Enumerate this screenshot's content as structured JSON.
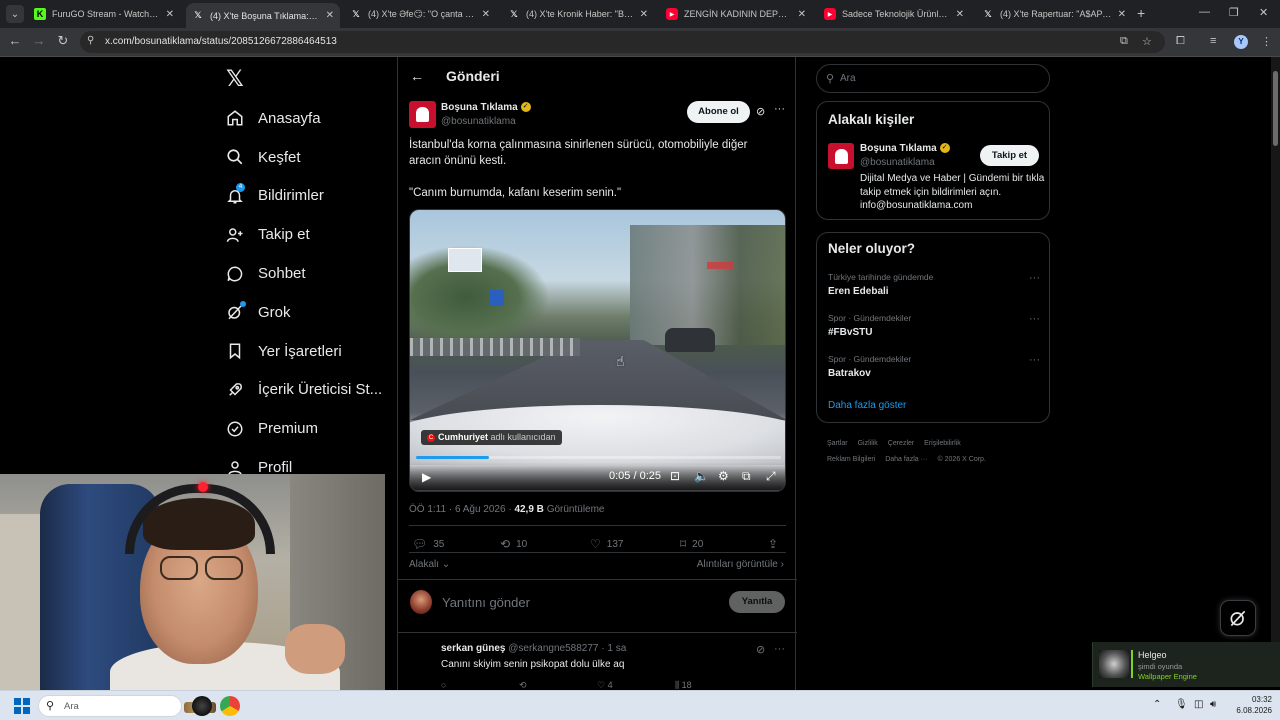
{
  "browser": {
    "tabs": [
      {
        "title": "FuruGO Stream - Watch Live on",
        "favicon": "kick-icon",
        "active": false
      },
      {
        "title": "(4) X'te Boşuna Tıklama: \"İstanb",
        "favicon": "x-icon",
        "active": true
      },
      {
        "title": "(4) X'te Əfe😏: \"O çanta ne aq",
        "favicon": "x-icon",
        "active": false
      },
      {
        "title": "(4) X'te Kronik Haber: \"Bir ev kı",
        "favicon": "x-icon",
        "active": false
      },
      {
        "title": "ZENGİN KADININ DEPOSUNU...",
        "favicon": "youtube-icon",
        "active": false
      },
      {
        "title": "Sadece Teknolojik Ürünler! Top",
        "favicon": "youtube-icon",
        "active": false
      },
      {
        "title": "(4) X'te Rapertuar: \"A$AP Rocky",
        "favicon": "x-icon",
        "active": false
      }
    ],
    "url": "x.com/bosunatiklama/status/2085126672886464513",
    "profile_initial": "Y"
  },
  "nav": {
    "items": [
      {
        "label": "Anasayfa",
        "icon": "home-icon"
      },
      {
        "label": "Keşfet",
        "icon": "search-icon"
      },
      {
        "label": "Bildirimler",
        "icon": "bell-icon",
        "badge": "4"
      },
      {
        "label": "Takip et",
        "icon": "person-add-icon"
      },
      {
        "label": "Sohbet",
        "icon": "chat-icon"
      },
      {
        "label": "Grok",
        "icon": "grok-icon"
      },
      {
        "label": "Yer İşaretleri",
        "icon": "bookmark-icon"
      },
      {
        "label": "İçerik Üreticisi St...",
        "icon": "rocket-icon"
      },
      {
        "label": "Premium",
        "icon": "verified-icon"
      },
      {
        "label": "Profil",
        "icon": "profile-icon"
      }
    ]
  },
  "post": {
    "header_title": "Gönderi",
    "author_name": "Boşuna Tıklama",
    "author_handle": "@bosunatiklama",
    "subscribe_label": "Abone ol",
    "text": "İstanbul'da korna çalınmasına sinirlenen sürücü, otomobiliyle diğer aracın önünü kesti.\n\n\"Canım burnumda, kafanı keserim senin.\"",
    "video": {
      "credit_source": "Cumhuriyet",
      "credit_suffix": "adlı kullanıcıdan",
      "time": "0:05 / 0:25",
      "progress": 0.2
    },
    "meta_time": "ÖÖ 1:11 · 6 Ağu 2026 ·",
    "views_count": "42,9 B",
    "views_label": "Görüntüleme",
    "stats": {
      "replies": "35",
      "reposts": "10",
      "likes": "137",
      "bookmarks": "20"
    },
    "sort_label": "Alakalı",
    "quotes_label": "Alıntıları görüntüle",
    "reply_placeholder": "Yanıtını gönder",
    "reply_button": "Yanıtla"
  },
  "comment": {
    "name": "serkan güneş",
    "handle_time": "@serkangne588277 · 1 sa",
    "text": "Canını skiyim senin psikopat dolu ülke aq",
    "likes": "4",
    "views": "18"
  },
  "sidebar": {
    "search_placeholder": "Ara",
    "related_title": "Alakalı kişiler",
    "related_name": "Boşuna Tıklama",
    "related_handle": "@bosunatiklama",
    "related_follow": "Takip et",
    "related_bio": "Dijital Medya ve Haber | Gündemi bir tıkla takip etmek için bildirimleri açın. info@bosunatiklama.com",
    "trends_title": "Neler oluyor?",
    "trends": [
      {
        "category": "Türkiye tarihinde gündemde",
        "name": "Eren Edebali"
      },
      {
        "category": "Spor · Gündemdekiler",
        "name": "#FBvSTU"
      },
      {
        "category": "Spor · Gündemdekiler",
        "name": "Batrakov"
      }
    ],
    "show_more": "Daha fazla göster",
    "footer": [
      "Şartlar",
      "Gizlilik",
      "Çerezler",
      "Erişilebilirlik",
      "Reklam Bilgileri",
      "Daha fazla ···",
      "© 2026 X Corp."
    ]
  },
  "notification": {
    "title": "Helgeo",
    "subtitle": "şimdi oyunda",
    "app": "Wallpaper Engine"
  },
  "taskbar": {
    "search_placeholder": "Ara",
    "time": "03:32",
    "date": "6.08.2026"
  },
  "colors": {
    "accent": "#1d9bf0",
    "verified": "#e2b719",
    "brand_red": "#c8102e",
    "wallpaper_green": "#7ed321"
  }
}
